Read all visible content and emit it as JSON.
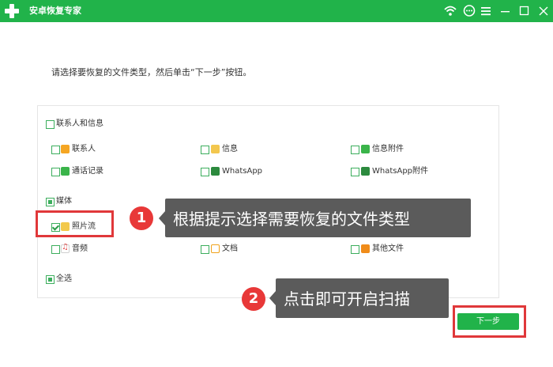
{
  "app": {
    "title": "安卓恢复专家"
  },
  "window": {
    "icons": [
      "wifi-icon",
      "chat-icon",
      "menu-icon",
      "minimize-icon",
      "maximize-icon",
      "close-icon"
    ],
    "accent": "#21b34a"
  },
  "instruction": "请选择要恢复的文件类型，然后单击“下一步”按钮。",
  "groups": {
    "contacts": {
      "label": "联系人和信息",
      "state": "unchecked",
      "items": [
        {
          "label": "联系人",
          "icon": "contact-icon",
          "checked": false
        },
        {
          "label": "信息",
          "icon": "message-icon",
          "checked": false
        },
        {
          "label": "信息附件",
          "icon": "attachment-icon",
          "checked": false
        },
        {
          "label": "通话记录",
          "icon": "call-log-icon",
          "checked": false
        },
        {
          "label": "WhatsApp",
          "icon": "whatsapp-icon",
          "checked": false
        },
        {
          "label": "WhatsApp附件",
          "icon": "whatsapp-attachment-icon",
          "checked": false
        }
      ]
    },
    "media": {
      "label": "媒体",
      "state": "partial",
      "items": [
        {
          "label": "照片流",
          "icon": "photo-stream-icon",
          "checked": true
        },
        {
          "label": "音频",
          "icon": "audio-icon",
          "checked": false
        },
        {
          "label": "文档",
          "icon": "document-icon",
          "checked": false
        },
        {
          "label": "其他文件",
          "icon": "other-files-icon",
          "checked": false
        }
      ]
    },
    "select_all": {
      "label": "全选",
      "state": "partial"
    }
  },
  "tips": [
    {
      "number": "1",
      "text": "根据提示选择需要恢复的文件类型"
    },
    {
      "number": "2",
      "text": "点击即可开启扫描"
    }
  ],
  "next_button": {
    "label": "下一步"
  },
  "highlight_color": "#e0383a"
}
